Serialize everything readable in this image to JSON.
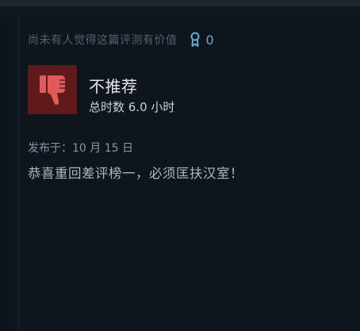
{
  "review": {
    "helpful_text": "尚未有人觉得这篇评测有价值",
    "award_count": "0",
    "verdict": "不推荐",
    "hours": "总时数 6.0 小时",
    "posted": "发布于：10 月 15 日",
    "body": "恭喜重回差评榜一，必须匡扶汉室！"
  },
  "colors": {
    "background": "#0e141c",
    "thumb_box": "#611a1c",
    "thumb_icon": "#e05a5a",
    "award_icon": "#6aa7d8"
  },
  "icons": {
    "award": "award-ribbon-icon",
    "thumb": "thumbs-down-icon"
  }
}
